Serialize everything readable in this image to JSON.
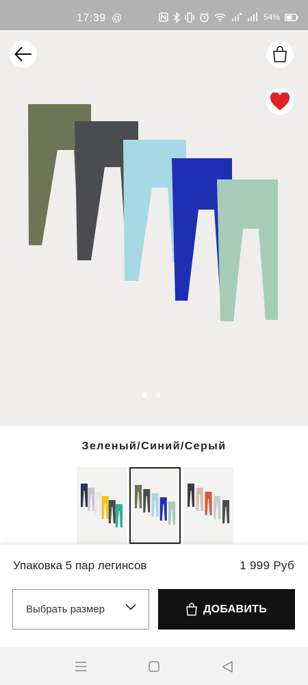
{
  "status_bar": {
    "time": "17:39",
    "at_symbol": "@",
    "battery": "54%"
  },
  "hero": {
    "background": "#efeeed",
    "favorite_color": "#e02226",
    "leggings_colors": [
      "#6e7554",
      "#4a4c4f",
      "#a7d8e6",
      "#1f2fb4",
      "#a6cbb7"
    ],
    "pagination": {
      "current": 1,
      "total": 2
    }
  },
  "color_name": "Зеленый/Синий/Серый",
  "thumbnails": [
    {
      "selected": false,
      "colors": [
        "#2b3550",
        "#c3c7cc",
        "#e8e8e8",
        "#f2c11e",
        "#4a4c4f",
        "#2bb28e"
      ]
    },
    {
      "selected": true,
      "colors": [
        "#6e7554",
        "#4a4c4f",
        "#a7d8e6",
        "#1f2fb4",
        "#a6cbb7"
      ]
    },
    {
      "selected": false,
      "colors": [
        "#3a3c40",
        "#d2c0a8",
        "#d9573f",
        "#c8cdd2",
        "#4a4c4f"
      ]
    }
  ],
  "product": {
    "name": "Упаковка 5 пар легинсов",
    "price": "1 999 Руб"
  },
  "size_select": {
    "label": "Выбрать размер"
  },
  "add_button": {
    "label": "ДОБАВИТЬ"
  },
  "nav_bar": {
    "items": [
      "menu-icon",
      "home-icon",
      "back-icon"
    ]
  }
}
